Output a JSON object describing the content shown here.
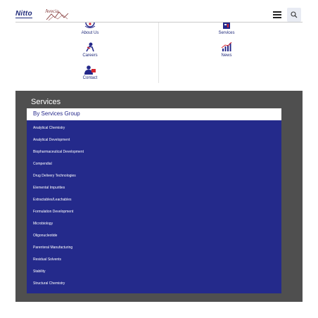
{
  "header": {
    "logo_primary": "Nitto",
    "logo_secondary": "Avecia",
    "menu_icon": "hamburger-icon",
    "search_icon": "search-icon"
  },
  "quick_links": [
    {
      "label": "About Us",
      "icon": "info-globe-icon"
    },
    {
      "label": "Services",
      "icon": "services-icon"
    },
    {
      "label": "Careers",
      "icon": "career-person-icon"
    },
    {
      "label": "News",
      "icon": "bar-chart-icon"
    },
    {
      "label": "Contact",
      "icon": "contact-person-icon"
    }
  ],
  "services": {
    "title": "Services",
    "group_label": "By Services Group",
    "items": [
      "Analytical Chemistry",
      "Analytical Development",
      "Biopharmaceutical Development",
      "Compendial",
      "Drug Delivery Technologies",
      "Elemental Impurities",
      "Extractables/Leachables",
      "Formulation Development",
      "Microbiology",
      "Oligonucleotide",
      "Parenteral Manufacturing",
      "Residual Solvents",
      "Stability",
      "Structural Chemistry"
    ]
  },
  "colors": {
    "brand_navy": "#242a8b",
    "panel_gray": "#4f4f4f",
    "accent_red": "#d6262f"
  }
}
